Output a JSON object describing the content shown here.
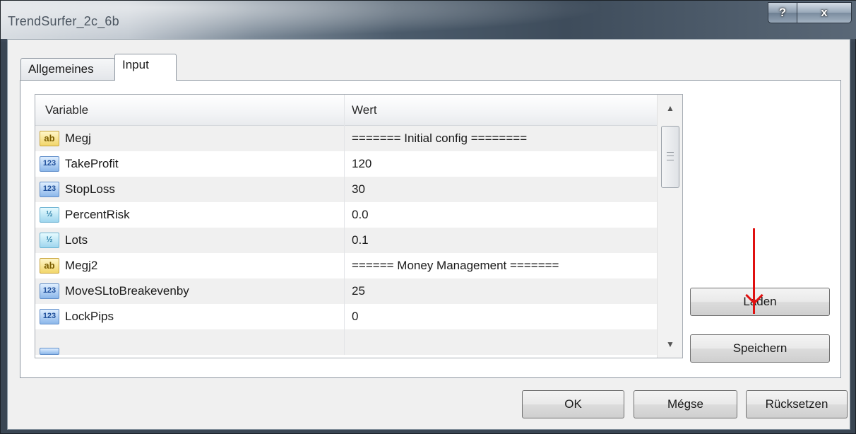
{
  "window": {
    "title": "TrendSurfer_2c_6b",
    "help_label": "?",
    "close_label": "x"
  },
  "tabs": [
    {
      "label": "Allgemeines",
      "selected": false
    },
    {
      "label": "Input",
      "selected": true
    }
  ],
  "grid": {
    "columns": {
      "variable": "Variable",
      "value": "Wert"
    },
    "rows": [
      {
        "type": "string",
        "icon": "ab",
        "name": "Megj",
        "value": "======= Initial config ========"
      },
      {
        "type": "int",
        "icon": "123",
        "name": "TakeProfit",
        "value": "120"
      },
      {
        "type": "int",
        "icon": "123",
        "name": "StopLoss",
        "value": "30"
      },
      {
        "type": "double",
        "icon": "½",
        "name": "PercentRisk",
        "value": "0.0"
      },
      {
        "type": "double",
        "icon": "½",
        "name": "Lots",
        "value": "0.1"
      },
      {
        "type": "string",
        "icon": "ab",
        "name": "Megj2",
        "value": "====== Money Management ======="
      },
      {
        "type": "int",
        "icon": "123",
        "name": "MoveSLtoBreakevenby",
        "value": "25"
      },
      {
        "type": "int",
        "icon": "123",
        "name": "LockPips",
        "value": "0"
      }
    ],
    "partial_row_icon": "123"
  },
  "buttons": {
    "load": "Laden",
    "save": "Speichern",
    "ok": "OK",
    "cancel": "Mégse",
    "reset": "Rücksetzen"
  },
  "colors": {
    "annotation_arrow": "#e01010"
  }
}
